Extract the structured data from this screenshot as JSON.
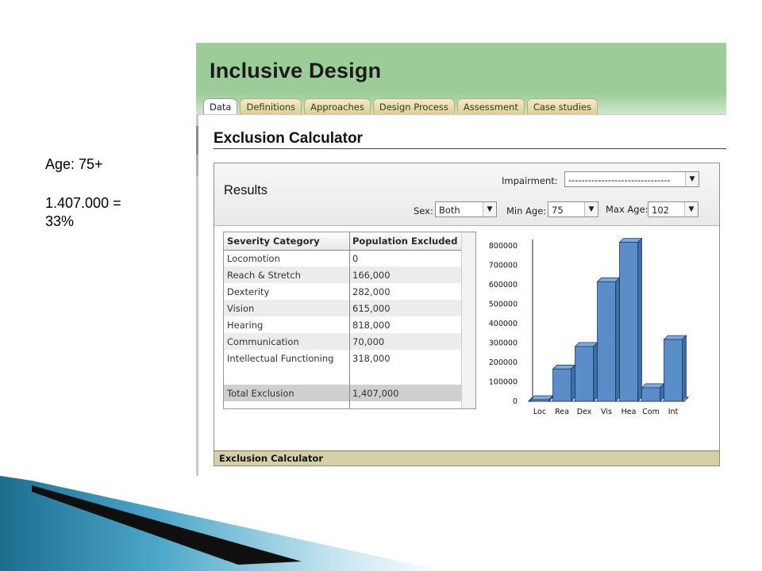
{
  "slide": {
    "age_label": "Age: 75+",
    "total_line": "1.407.000 =",
    "percent_line": "33%"
  },
  "app": {
    "title": "Inclusive Design",
    "tabs": [
      {
        "label": "Data",
        "active": true
      },
      {
        "label": "Definitions"
      },
      {
        "label": "Approaches"
      },
      {
        "label": "Design Process"
      },
      {
        "label": "Assessment"
      },
      {
        "label": "Case studies"
      }
    ]
  },
  "calculator": {
    "section_title": "Exclusion Calculator",
    "results_title": "Results",
    "impairment": {
      "label": "Impairment:",
      "value": "-------------------------------"
    },
    "sex": {
      "label": "Sex:",
      "value": "Both"
    },
    "min_age": {
      "label": "Min Age:",
      "value": "75"
    },
    "max_age": {
      "label": "Max Age:",
      "value": "102"
    },
    "table": {
      "headers": [
        "Severity Category",
        "Population Excluded"
      ],
      "rows": [
        [
          "Locomotion",
          "0"
        ],
        [
          "Reach & Stretch",
          "166,000"
        ],
        [
          "Dexterity",
          "282,000"
        ],
        [
          "Vision",
          "615,000"
        ],
        [
          "Hearing",
          "818,000"
        ],
        [
          "Communication",
          "70,000"
        ],
        [
          "Intellectual Functioning",
          "318,000"
        ]
      ],
      "total": [
        "Total Exclusion",
        "1,407,000"
      ]
    },
    "status_bar": "Exclusion Calculator"
  },
  "colors": {
    "header_green": "#9ccc98",
    "bar_blue": "#5b8ec9",
    "tab_tan": "#dccf96",
    "status_tan": "#d4d0a6"
  },
  "chart_data": {
    "type": "bar",
    "categories": [
      "Loc",
      "Rea",
      "Dex",
      "Vis",
      "Hea",
      "Com",
      "Int"
    ],
    "values": [
      0,
      166000,
      282000,
      615000,
      818000,
      70000,
      318000
    ],
    "ytick_labels": [
      "0",
      "100000",
      "200000",
      "300000",
      "400000",
      "500000",
      "600000",
      "700000",
      "800000"
    ],
    "ylim": [
      0,
      800000
    ],
    "title": "",
    "xlabel": "",
    "ylabel": "",
    "style": "3d"
  }
}
